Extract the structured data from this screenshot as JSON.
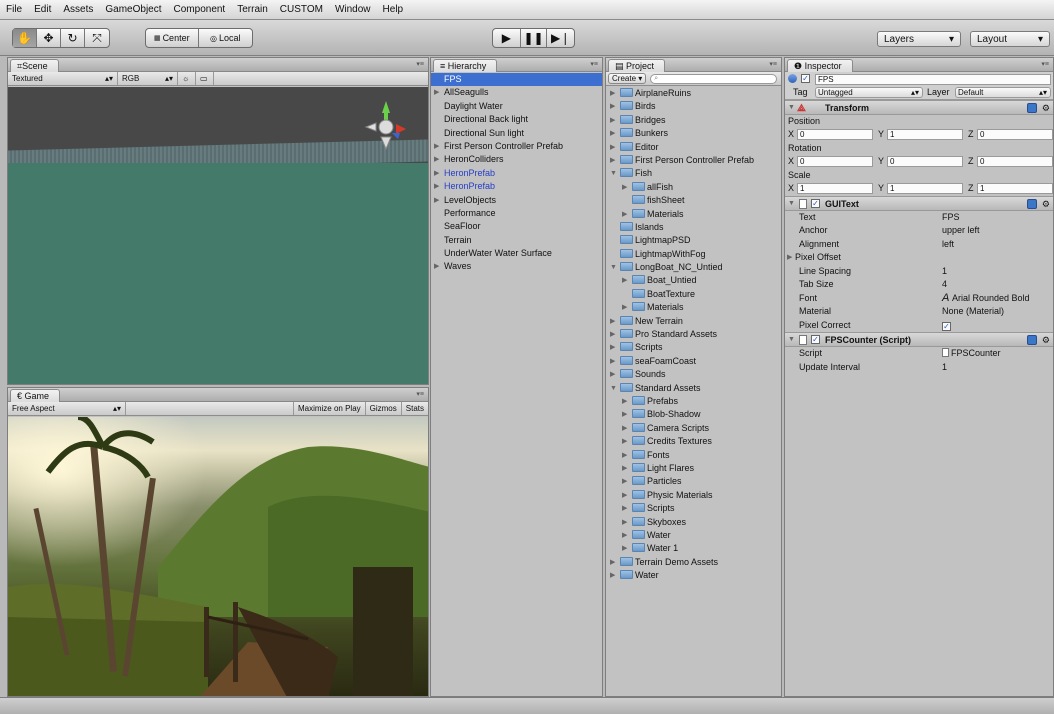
{
  "menubar": [
    "File",
    "Edit",
    "Assets",
    "GameObject",
    "Component",
    "Terrain",
    "CUSTOM",
    "Window",
    "Help"
  ],
  "toolbar": {
    "tool_icons": [
      "hand-icon",
      "move-icon",
      "rotate-icon",
      "scale-icon"
    ],
    "pivot": "Center",
    "space": "Local",
    "play_icons": [
      "play-icon",
      "pause-icon",
      "step-icon"
    ],
    "layers": "Layers",
    "layout": "Layout"
  },
  "scene": {
    "tab": "Scene",
    "mode": "Textured",
    "channel": "RGB"
  },
  "game": {
    "tab": "Game",
    "aspect": "Free Aspect",
    "maximize": "Maximize on Play",
    "gizmos": "Gizmos",
    "stats": "Stats"
  },
  "hierarchy": {
    "tab": "Hierarchy",
    "items": [
      {
        "label": "FPS",
        "selected": true
      },
      {
        "label": "AllSeagulls",
        "arrow": true
      },
      {
        "label": "Daylight Water"
      },
      {
        "label": "Directional Back light"
      },
      {
        "label": "Directional Sun light"
      },
      {
        "label": "First Person Controller Prefab",
        "arrow": true
      },
      {
        "label": "HeronColliders",
        "arrow": true
      },
      {
        "label": "HeronPrefab",
        "arrow": true,
        "prefab": true
      },
      {
        "label": "HeronPrefab",
        "arrow": true,
        "prefab": true
      },
      {
        "label": "LevelObjects",
        "arrow": true
      },
      {
        "label": "Performance"
      },
      {
        "label": "SeaFloor"
      },
      {
        "label": "Terrain"
      },
      {
        "label": "UnderWater Water Surface"
      },
      {
        "label": "Waves",
        "arrow": true
      }
    ]
  },
  "project": {
    "tab": "Project",
    "create": "Create",
    "items": [
      {
        "label": "AirplaneRuins",
        "depth": 0,
        "arrow": "right"
      },
      {
        "label": "Birds",
        "depth": 0,
        "arrow": "right"
      },
      {
        "label": "Bridges",
        "depth": 0,
        "arrow": "right"
      },
      {
        "label": "Bunkers",
        "depth": 0,
        "arrow": "right"
      },
      {
        "label": "Editor",
        "depth": 0,
        "arrow": "right"
      },
      {
        "label": "First Person Controller Prefab",
        "depth": 0,
        "arrow": "right"
      },
      {
        "label": "Fish",
        "depth": 0,
        "arrow": "down"
      },
      {
        "label": "allFish",
        "depth": 1,
        "arrow": "right"
      },
      {
        "label": "fishSheet",
        "depth": 1
      },
      {
        "label": "Materials",
        "depth": 1,
        "arrow": "right"
      },
      {
        "label": "Islands",
        "depth": 0
      },
      {
        "label": "LightmapPSD",
        "depth": 0
      },
      {
        "label": "LightmapWithFog",
        "depth": 0
      },
      {
        "label": "LongBoat_NC_Untied",
        "depth": 0,
        "arrow": "down"
      },
      {
        "label": "Boat_Untied",
        "depth": 1,
        "arrow": "right"
      },
      {
        "label": "BoatTexture",
        "depth": 1
      },
      {
        "label": "Materials",
        "depth": 1,
        "arrow": "right"
      },
      {
        "label": "New Terrain",
        "depth": 0,
        "arrow": "right"
      },
      {
        "label": "Pro Standard Assets",
        "depth": 0,
        "arrow": "right"
      },
      {
        "label": "Scripts",
        "depth": 0,
        "arrow": "right"
      },
      {
        "label": "seaFoamCoast",
        "depth": 0,
        "arrow": "right"
      },
      {
        "label": "Sounds",
        "depth": 0,
        "arrow": "right"
      },
      {
        "label": "Standard Assets",
        "depth": 0,
        "arrow": "down"
      },
      {
        "label": "Prefabs",
        "depth": 1,
        "arrow": "right"
      },
      {
        "label": "Blob-Shadow",
        "depth": 1,
        "arrow": "right"
      },
      {
        "label": "Camera Scripts",
        "depth": 1,
        "arrow": "right"
      },
      {
        "label": "Credits Textures",
        "depth": 1,
        "arrow": "right"
      },
      {
        "label": "Fonts",
        "depth": 1,
        "arrow": "right"
      },
      {
        "label": "Light Flares",
        "depth": 1,
        "arrow": "right"
      },
      {
        "label": "Particles",
        "depth": 1,
        "arrow": "right"
      },
      {
        "label": "Physic Materials",
        "depth": 1,
        "arrow": "right"
      },
      {
        "label": "Scripts",
        "depth": 1,
        "arrow": "right"
      },
      {
        "label": "Skyboxes",
        "depth": 1,
        "arrow": "right"
      },
      {
        "label": "Water",
        "depth": 1,
        "arrow": "right"
      },
      {
        "label": "Water 1",
        "depth": 1,
        "arrow": "right"
      },
      {
        "label": "Terrain Demo Assets",
        "depth": 0,
        "arrow": "right"
      },
      {
        "label": "Water",
        "depth": 0,
        "arrow": "right"
      }
    ]
  },
  "inspector": {
    "tab": "Inspector",
    "object_name": "FPS",
    "tag_label": "Tag",
    "tag_value": "Untagged",
    "layer_label": "Layer",
    "layer_value": "Default",
    "transform": {
      "title": "Transform",
      "position_label": "Position",
      "rotation_label": "Rotation",
      "scale_label": "Scale",
      "axes": [
        "X",
        "Y",
        "Z"
      ],
      "position": [
        "0",
        "1",
        "0"
      ],
      "rotation": [
        "0",
        "0",
        "0"
      ],
      "scale": [
        "1",
        "1",
        "1"
      ]
    },
    "guitext": {
      "title": "GUIText",
      "props": [
        {
          "label": "Text",
          "value": "FPS"
        },
        {
          "label": "Anchor",
          "value": "upper left"
        },
        {
          "label": "Alignment",
          "value": "left"
        },
        {
          "label": "Pixel Offset",
          "value": "",
          "arrow": true
        },
        {
          "label": "Line Spacing",
          "value": "1"
        },
        {
          "label": "Tab Size",
          "value": "4"
        },
        {
          "label": "Font",
          "value": "Arial Rounded Bold"
        },
        {
          "label": "Material",
          "value": "None (Material)"
        },
        {
          "label": "Pixel Correct",
          "value": "✓"
        }
      ]
    },
    "fpscounter": {
      "title": "FPSCounter (Script)",
      "props": [
        {
          "label": "Script",
          "value": "FPSCounter"
        },
        {
          "label": "Update Interval",
          "value": "1"
        }
      ]
    }
  }
}
